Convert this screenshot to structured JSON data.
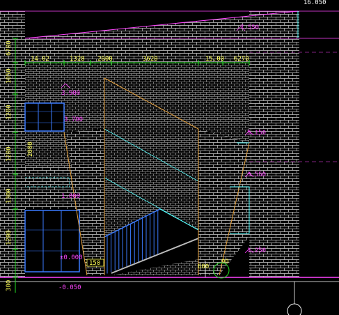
{
  "colors": {
    "background": "#000000",
    "brick": "#d9d9d9",
    "dimension": "#ffff55",
    "dim_green": "#22e022",
    "level": "#ff44ff",
    "cyan": "#55ffff",
    "orange": "#e8a23c",
    "blue": "#3b7bff",
    "white": "#ffffff"
  },
  "left_dimensions": [
    "6700",
    "1050",
    "1200",
    "1200",
    "1300",
    "1200",
    "300"
  ],
  "top_dimensions": [
    "14.02",
    "1328",
    "2000",
    "3620",
    "15.00",
    "6270"
  ],
  "window_dimension": "2000",
  "elevations": {
    "roof_top": "16.050",
    "roof_upper": "7.550",
    "level_3900": "3.900",
    "level_3700": "3.700",
    "level_5150": "5.150",
    "level_3550": "3.550",
    "level_1800": "1.800",
    "level_1250": "1.250",
    "ground": "±0.000",
    "base": "-0.050"
  },
  "bottom_labels": {
    "left_small": "150",
    "right_small": "600",
    "corner_small": "90"
  },
  "icons": [
    "level-marker-icon",
    "axis-circle-icon",
    "stair-icon"
  ]
}
